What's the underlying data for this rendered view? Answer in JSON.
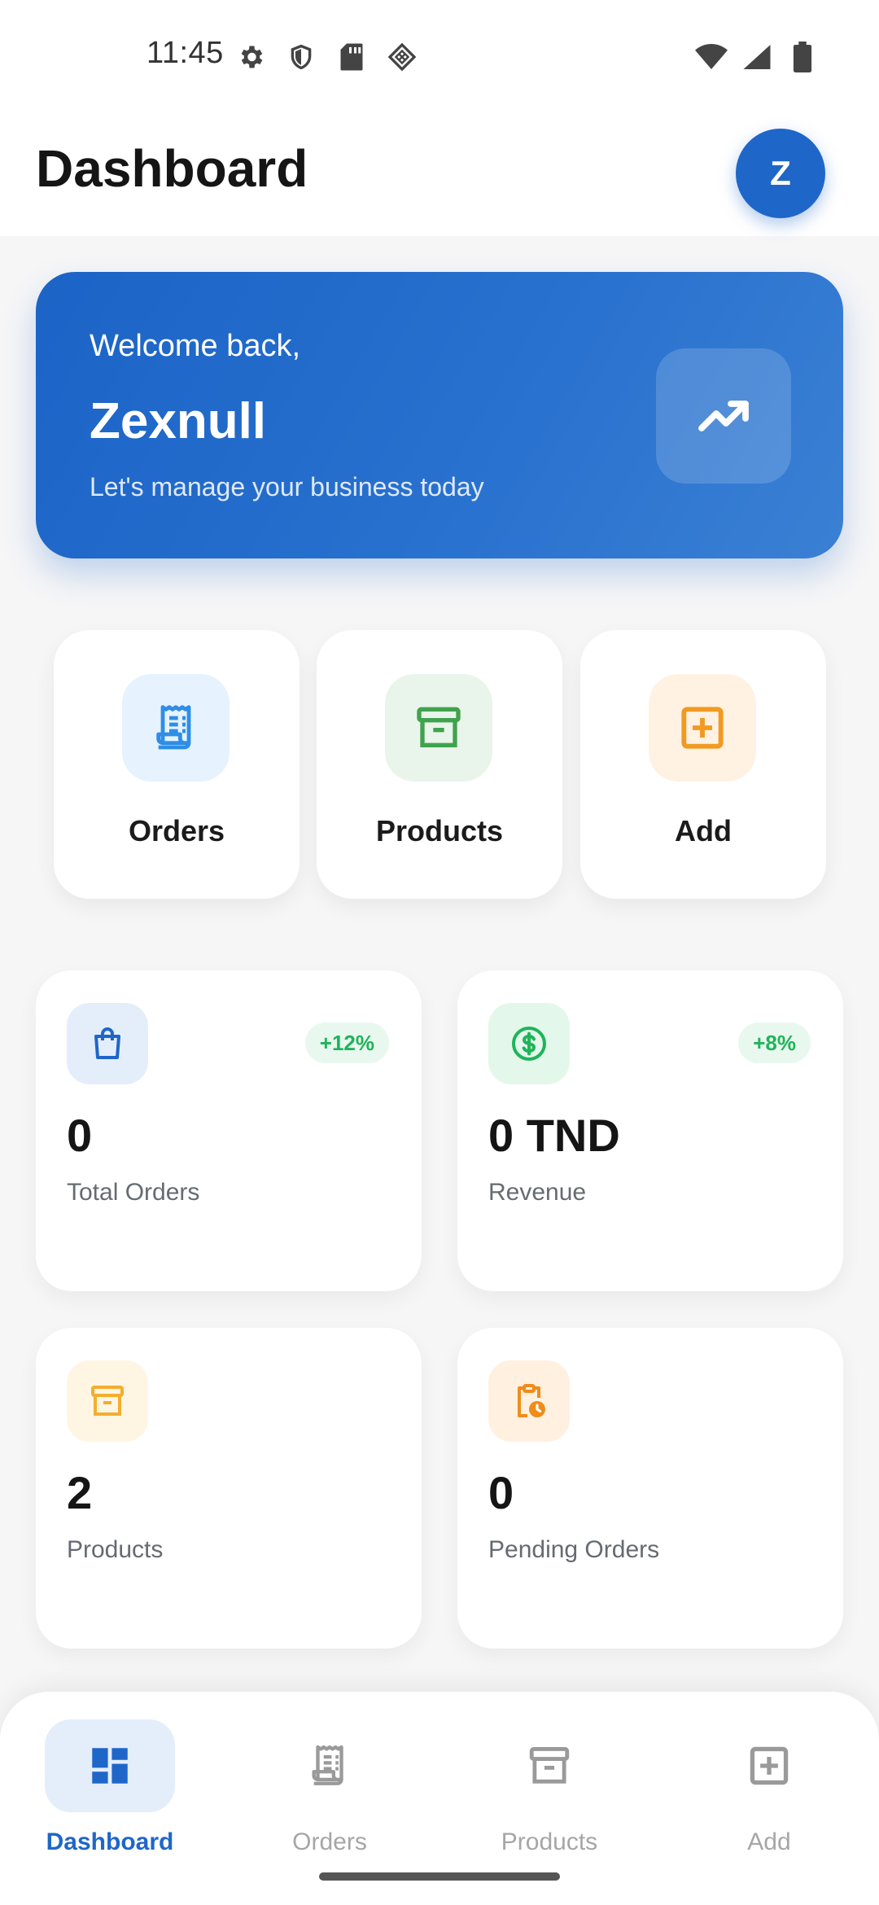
{
  "status": {
    "time": "11:45"
  },
  "header": {
    "title": "Dashboard",
    "avatar_initial": "Z"
  },
  "welcome": {
    "greeting": "Welcome back,",
    "name": "Zexnull",
    "subtitle": "Let's manage your business today"
  },
  "quick_actions": [
    {
      "label": "Orders",
      "icon": "receipt-icon"
    },
    {
      "label": "Products",
      "icon": "archive-box-icon"
    },
    {
      "label": "Add",
      "icon": "add-box-icon"
    }
  ],
  "stats": [
    {
      "value": "0",
      "label": "Total Orders",
      "trend": "+12%",
      "icon": "shopping-bag-icon"
    },
    {
      "value": "0 TND",
      "label": "Revenue",
      "trend": "+8%",
      "icon": "dollar-circle-icon"
    },
    {
      "value": "2",
      "label": "Products",
      "icon": "archive-box-icon"
    },
    {
      "value": "0",
      "label": "Pending Orders",
      "icon": "clipboard-clock-icon"
    }
  ],
  "bottom_nav": [
    {
      "label": "Dashboard",
      "active": true
    },
    {
      "label": "Orders",
      "active": false
    },
    {
      "label": "Products",
      "active": false
    },
    {
      "label": "Add",
      "active": false
    }
  ],
  "colors": {
    "primary": "#1f66c9",
    "orders_tint": "#e6f2fd",
    "products_tint": "#e9f5ea",
    "add_tint": "#fff2e3",
    "trend_green": "#1fb45a"
  }
}
